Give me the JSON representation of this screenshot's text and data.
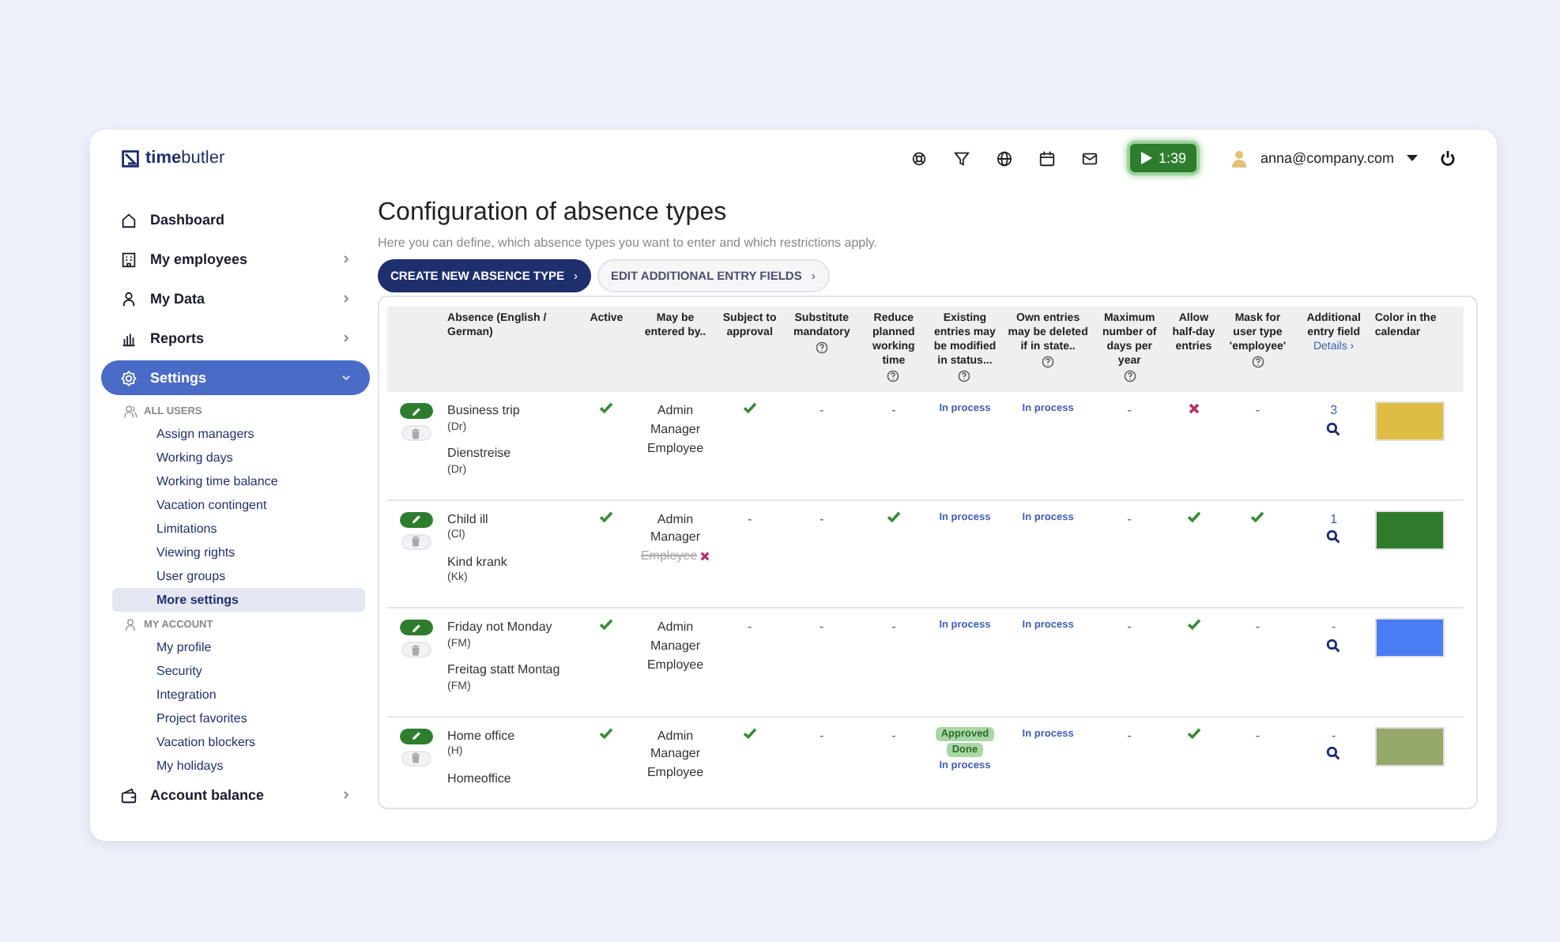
{
  "topbar": {
    "logo": "**time**butler",
    "timer": "1:39",
    "user": "anna@company.com"
  },
  "sidebar": {
    "items": [
      {
        "label": "Dashboard",
        "selected": false
      },
      {
        "label": "My employees",
        "selected": false,
        "expanded": false
      },
      {
        "label": "My Data",
        "selected": false,
        "expanded": false
      },
      {
        "label": "Reports",
        "selected": false,
        "expanded": false
      },
      {
        "label": "Settings",
        "selected": true,
        "expanded": true,
        "groups": [
          {
            "title": "ALL USERS",
            "items": [
              {
                "label": "Assign managers",
                "selected": false
              },
              {
                "label": "Working days",
                "selected": false
              },
              {
                "label": "Working time balance",
                "selected": false
              },
              {
                "label": "Vacation contingent",
                "selected": false
              },
              {
                "label": "Limitations",
                "selected": false
              },
              {
                "label": "Viewing rights",
                "selected": false
              },
              {
                "label": "User groups",
                "selected": false
              },
              {
                "label": "More settings",
                "selected": true
              }
            ]
          },
          {
            "title": "MY ACCOUNT",
            "items": [
              {
                "label": "My profile",
                "selected": false
              },
              {
                "label": "Security",
                "selected": false
              },
              {
                "label": "Integration",
                "selected": false
              },
              {
                "label": "Project favorites",
                "selected": false
              },
              {
                "label": "Vacation blockers",
                "selected": false
              },
              {
                "label": "My holidays",
                "selected": false
              }
            ]
          }
        ]
      },
      {
        "label": "Account balance",
        "selected": false,
        "expanded": false
      }
    ]
  },
  "page": {
    "title": "Configuration of absence types",
    "subtitle": "Here you can define, which absence types you want to enter and which restrictions apply.",
    "buttons": [
      {
        "label": "CREATE NEW ABSENCE TYPE",
        "kind": "primary",
        "chevron": "›"
      },
      {
        "label": "EDIT ADDITIONAL ENTRY FIELDS",
        "kind": "secondary",
        "chevron": "›"
      }
    ]
  },
  "table": {
    "columns": [
      {
        "label": "Absence (English / German)",
        "help": false
      },
      {
        "label": "Active",
        "help": false
      },
      {
        "label": "May be entered by..",
        "help": false
      },
      {
        "label": "Subject to approval",
        "help": false
      },
      {
        "label": "Substitute mandatory",
        "help": true
      },
      {
        "label": "Reduce planned working time",
        "help": true
      },
      {
        "label": "Existing entries may be modified in status...",
        "help": true
      },
      {
        "label": "Own entries may be deleted if in state..",
        "help": true
      },
      {
        "label": "Maximum number of days per year",
        "help": true
      },
      {
        "label": "Allow half-day entries",
        "help": false
      },
      {
        "label": "Mask for user type 'employee'",
        "help": true
      },
      {
        "label": "Additional entry field",
        "help": false,
        "link": "Details ›"
      },
      {
        "label": "Color in the calendar",
        "help": false
      }
    ],
    "rows": [
      {
        "names": [
          {
            "label": "Business trip",
            "abbr": "(Dr)"
          },
          {
            "label": "Dienstreise",
            "abbr": "(Dr)"
          }
        ],
        "active": {
          "kind": "check"
        },
        "roles": [
          {
            "label": "Admin",
            "allowed": true
          },
          {
            "label": "Manager",
            "allowed": true
          },
          {
            "label": "Employee",
            "allowed": true
          }
        ],
        "approval": {
          "kind": "check"
        },
        "substitute": {
          "kind": "text",
          "text": "-"
        },
        "reduce": {
          "kind": "text",
          "text": "-"
        },
        "existing": [
          {
            "label": "In process",
            "kind": "in_process"
          }
        ],
        "own": [
          {
            "label": "In process",
            "kind": "in_process"
          }
        ],
        "max_days": {
          "kind": "text",
          "text": "-"
        },
        "half_day": {
          "kind": "cross"
        },
        "mask": {
          "kind": "text",
          "text": "-"
        },
        "additional": "3",
        "color": "#dfbd45"
      },
      {
        "names": [
          {
            "label": "Child ill",
            "abbr": "(Cl)"
          },
          {
            "label": "Kind krank",
            "abbr": "(Kk)"
          }
        ],
        "active": {
          "kind": "check"
        },
        "roles": [
          {
            "label": "Admin",
            "allowed": true
          },
          {
            "label": "Manager",
            "allowed": true
          },
          {
            "label": "Employee",
            "allowed": false
          }
        ],
        "approval": {
          "kind": "text",
          "text": "-"
        },
        "substitute": {
          "kind": "text",
          "text": "-"
        },
        "reduce": {
          "kind": "check"
        },
        "existing": [
          {
            "label": "In process",
            "kind": "in_process"
          }
        ],
        "own": [
          {
            "label": "In process",
            "kind": "in_process"
          }
        ],
        "max_days": {
          "kind": "text",
          "text": "-"
        },
        "half_day": {
          "kind": "check"
        },
        "mask": {
          "kind": "check"
        },
        "additional": "1",
        "color": "#2f7d2c"
      },
      {
        "names": [
          {
            "label": "Friday not Monday",
            "abbr": "(FM)"
          },
          {
            "label": "Freitag statt Montag",
            "abbr": "(FM)"
          }
        ],
        "active": {
          "kind": "check"
        },
        "roles": [
          {
            "label": "Admin",
            "allowed": true
          },
          {
            "label": "Manager",
            "allowed": true
          },
          {
            "label": "Employee",
            "allowed": true
          }
        ],
        "approval": {
          "kind": "text",
          "text": "-"
        },
        "substitute": {
          "kind": "text",
          "text": "-"
        },
        "reduce": {
          "kind": "text",
          "text": "-"
        },
        "existing": [
          {
            "label": "In process",
            "kind": "in_process"
          }
        ],
        "own": [
          {
            "label": "In process",
            "kind": "in_process"
          }
        ],
        "max_days": {
          "kind": "text",
          "text": "-"
        },
        "half_day": {
          "kind": "check"
        },
        "mask": {
          "kind": "text",
          "text": "-"
        },
        "additional": "-",
        "color": "#4a7cf2"
      },
      {
        "names": [
          {
            "label": "Home office",
            "abbr": "(H)"
          },
          {
            "label": "Homeoffice"
          }
        ],
        "active": {
          "kind": "check"
        },
        "roles": [
          {
            "label": "Admin",
            "allowed": true
          },
          {
            "label": "Manager",
            "allowed": true
          },
          {
            "label": "Employee",
            "allowed": true
          }
        ],
        "approval": {
          "kind": "check"
        },
        "substitute": {
          "kind": "text",
          "text": "-"
        },
        "reduce": {
          "kind": "text",
          "text": "-"
        },
        "existing": [
          {
            "label": "Approved",
            "kind": "approved"
          },
          {
            "label": "Done",
            "kind": "approved"
          },
          {
            "label": "In process",
            "kind": "in_process"
          }
        ],
        "own": [
          {
            "label": "In process",
            "kind": "in_process"
          }
        ],
        "max_days": {
          "kind": "text",
          "text": "-"
        },
        "half_day": {
          "kind": "check"
        },
        "mask": {
          "kind": "text",
          "text": "-"
        },
        "additional": "-",
        "color": "#97a86b"
      }
    ]
  }
}
